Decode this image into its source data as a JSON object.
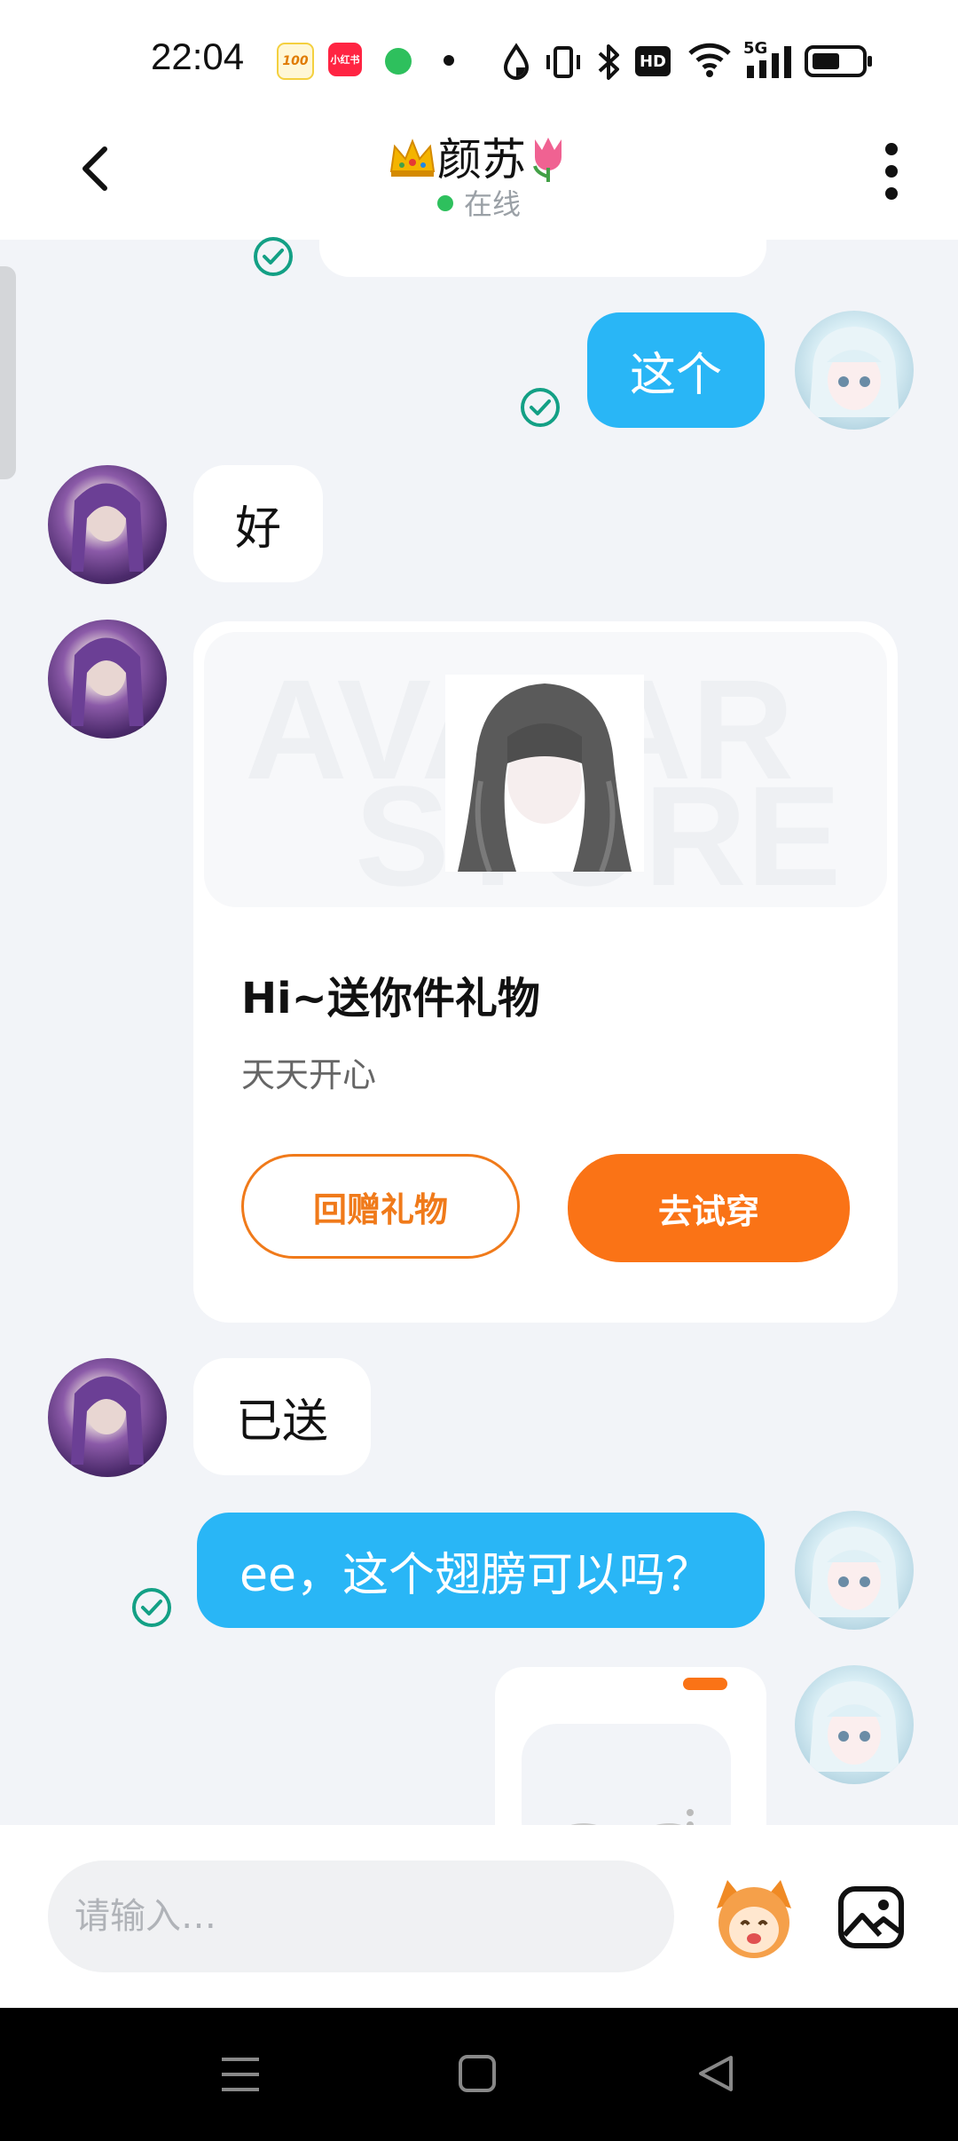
{
  "status_bar": {
    "time": "22:04",
    "app_icons": [
      {
        "name": "score-100-app",
        "label": "100",
        "color": "#f4d03f"
      },
      {
        "name": "xiaohongshu-app",
        "label": "小红书",
        "color": "#ff2442"
      },
      {
        "name": "message-app",
        "label": "",
        "color": "#2ec05d"
      }
    ],
    "network": "5G",
    "hd_label": "HD"
  },
  "header": {
    "title": "颜苏",
    "status": "在线",
    "crown_icon": "crown-icon",
    "flower_icon": "tulip-icon"
  },
  "messages": [
    {
      "id": "m1",
      "sender": "me",
      "text": "这个"
    },
    {
      "id": "m2",
      "sender": "them",
      "text": "好"
    },
    {
      "id": "m3",
      "sender": "them",
      "type": "gift"
    },
    {
      "id": "m4",
      "sender": "them",
      "text": "已送"
    },
    {
      "id": "m5",
      "sender": "me",
      "text": "ee，这个翅膀可以吗？"
    }
  ],
  "gift_card": {
    "title": "Hi~送你件礼物",
    "subtitle": "天天开心",
    "button_return": "回赠礼物",
    "button_try": "去试穿",
    "watermark_line1": "AVATAR",
    "watermark_line2": "STORE"
  },
  "input": {
    "placeholder": "请输入…"
  },
  "colors": {
    "my_bubble": "#29b6f6",
    "accent_orange": "#fa7316",
    "online_dot": "#2ec05d"
  }
}
